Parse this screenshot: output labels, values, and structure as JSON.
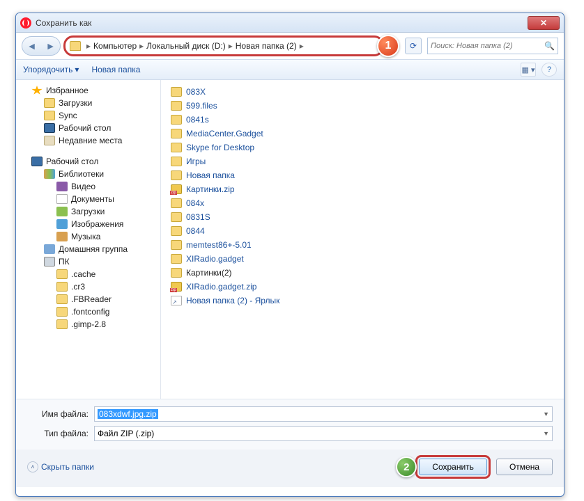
{
  "window": {
    "title": "Сохранить как"
  },
  "breadcrumb": [
    "Компьютер",
    "Локальный диск (D:)",
    "Новая папка (2)"
  ],
  "callouts": {
    "one": "1",
    "two": "2"
  },
  "search": {
    "placeholder": "Поиск: Новая папка (2)"
  },
  "toolbar": {
    "organize": "Упорядочить",
    "new_folder": "Новая папка"
  },
  "tree": {
    "favorites": "Избранное",
    "downloads": "Загрузки",
    "sync": "Sync",
    "desktop": "Рабочий стол",
    "recent": "Недавние места",
    "desktop2": "Рабочий стол",
    "libraries": "Библиотеки",
    "video": "Видео",
    "documents": "Документы",
    "downloads2": "Загрузки",
    "images": "Изображения",
    "music": "Музыка",
    "homegroup": "Домашняя группа",
    "pc": "ПК",
    "cache": ".cache",
    "cr3": ".cr3",
    "fbreader": ".FBReader",
    "fontconfig": ".fontconfig",
    "gimp": ".gimp-2.8"
  },
  "files": [
    {
      "name": "083X",
      "icon": "folder"
    },
    {
      "name": "599.files",
      "icon": "folder"
    },
    {
      "name": "0841s",
      "icon": "folder"
    },
    {
      "name": "MediaCenter.Gadget",
      "icon": "folder"
    },
    {
      "name": "Skype for Desktop",
      "icon": "folder"
    },
    {
      "name": "Игры",
      "icon": "folder"
    },
    {
      "name": "Новая папка",
      "icon": "folder"
    },
    {
      "name": "Картинки.zip",
      "icon": "zip"
    },
    {
      "name": "084x",
      "icon": "folder"
    },
    {
      "name": "0831S",
      "icon": "folder"
    },
    {
      "name": "0844",
      "icon": "folder"
    },
    {
      "name": "memtest86+-5.01",
      "icon": "folder"
    },
    {
      "name": "XIRadio.gadget",
      "icon": "folder"
    },
    {
      "name": "Картинки(2)",
      "icon": "folder"
    },
    {
      "name": "XIRadio.gadget.zip",
      "icon": "zip"
    },
    {
      "name": "Новая папка (2) - Ярлык",
      "icon": "link"
    }
  ],
  "form": {
    "filename_label": "Имя файла:",
    "filename_value": "083xdwf.jpg.zip",
    "filetype_label": "Тип файла:",
    "filetype_value": "Файл ZIP (.zip)"
  },
  "footer": {
    "hide_folders": "Скрыть папки",
    "save": "Сохранить",
    "cancel": "Отмена"
  }
}
